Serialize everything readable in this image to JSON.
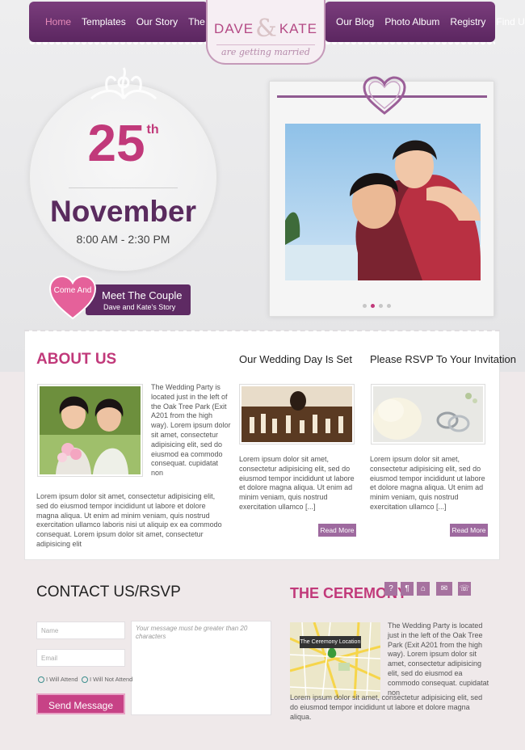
{
  "nav": {
    "left": [
      "Home",
      "Templates",
      "Our Story",
      "The Wedding"
    ],
    "right": [
      "Our Blog",
      "Photo Album",
      "Registry",
      "Find Us"
    ],
    "active": "Home"
  },
  "logo": {
    "name1": "DAVE",
    "amp": "&",
    "name2": "KATE",
    "tagline": "are getting married"
  },
  "date": {
    "day": "25",
    "suffix": "th",
    "month": "November",
    "time": "8:00 AM - 2:30 PM"
  },
  "couple": {
    "heart_text": "Come And",
    "title": "Meet The Couple",
    "subtitle": "Dave and Kate's Story"
  },
  "slider": {
    "dots": 4,
    "active_index": 1
  },
  "about": {
    "title": "ABOUT US",
    "side_text": "The Wedding Party is located just in the left of the Oak Tree Park (Exit A201 from the high way). Lorem ipsum dolor sit amet, consectetur adipisicing elit, sed do eiusmod ea commodo consequat. cupidatat non",
    "body": "Lorem ipsum dolor sit amet, consectetur adipisicing elit, sed do eiusmod tempor incididunt ut labore et dolore magna aliqua. Ut enim ad minim veniam, quis nostrud exercitation ullamco laboris nisi ut aliquip ex ea commodo consequat. Lorem ipsum dolor sit amet, consectetur adipisicing elit"
  },
  "wedding": {
    "title": "Our Wedding Day Is Set",
    "text": "Lorem ipsum dolor sit amet, consectetur adipisicing elit, sed do eiusmod tempor incididunt ut labore et dolore magna aliqua. Ut enim ad minim veniam, quis nostrud exercitation ullamco [...]",
    "button": "Read More"
  },
  "rsvp_invite": {
    "title": "Please RSVP To Your Invitation",
    "text": "Lorem ipsum dolor sit amet, consectetur adipisicing elit, sed do eiusmod tempor incididunt ut labore et dolore magna aliqua. Ut enim ad minim veniam, quis nostrud exercitation ullamco [...]",
    "button": "Read More"
  },
  "contact": {
    "title": "CONTACT US/RSVP",
    "name_placeholder": "Name",
    "email_placeholder": "Email",
    "message_placeholder": "Your message must be greater than 20 characters",
    "attend": "I Will Attend",
    "not_attend": "I Will Not Attend",
    "send": "Send Message"
  },
  "ceremony": {
    "title": "THE CEREMONY",
    "icons": [
      "?",
      "¶",
      "⌂",
      "✉",
      "☏"
    ],
    "icon_names": [
      "help-icon",
      "dining-icon",
      "cocktail-icon",
      "car-icon",
      "restroom-icon"
    ],
    "map_label": "The Ceremony Location",
    "text1": "The Wedding Party is located just in the left of the Oak Tree Park (Exit A201 from the high way). Lorem ipsum dolor sit amet, consectetur adipisicing elit, sed do eiusmod ea commodo consequat. cupidatat non",
    "text2": "Lorem ipsum dolor sit amet, consectetur adipisicing elit, sed do eiusmod tempor incididunt ut labore et dolore magna aliqua."
  },
  "colors": {
    "accent": "#c1397a",
    "purple": "#5e2a63",
    "button": "#9e6a9f"
  }
}
